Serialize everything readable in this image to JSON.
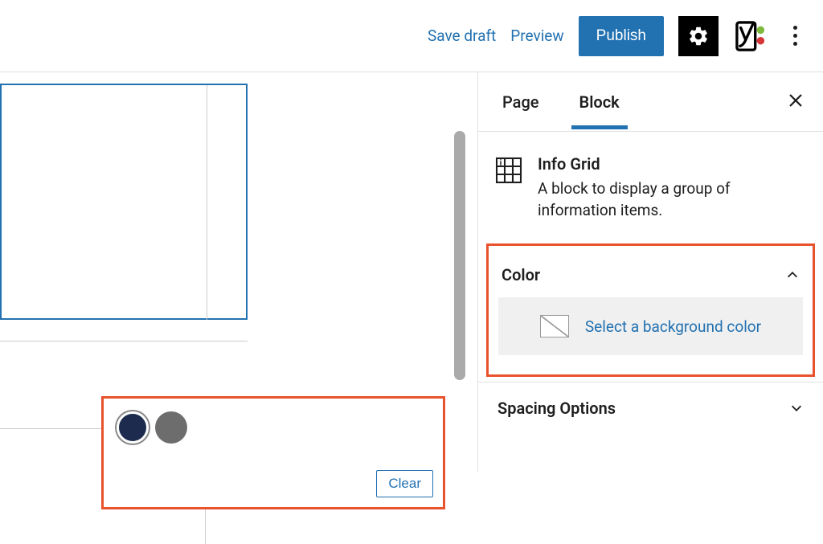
{
  "toolbar": {
    "save_draft": "Save draft",
    "preview": "Preview",
    "publish": "Publish"
  },
  "sidebar": {
    "tabs": {
      "page": "Page",
      "block": "Block"
    },
    "block_info": {
      "title": "Info Grid",
      "description": "A block to display a group of information items."
    },
    "panels": {
      "color": {
        "title": "Color",
        "select_bg": "Select a background color"
      },
      "spacing": {
        "title": "Spacing Options"
      }
    }
  },
  "color_popover": {
    "clear": "Clear",
    "swatches": [
      {
        "color": "#1c2b4e",
        "name": "navy",
        "selected": true
      },
      {
        "color": "#6d6d6d",
        "name": "gray",
        "selected": false
      }
    ]
  }
}
